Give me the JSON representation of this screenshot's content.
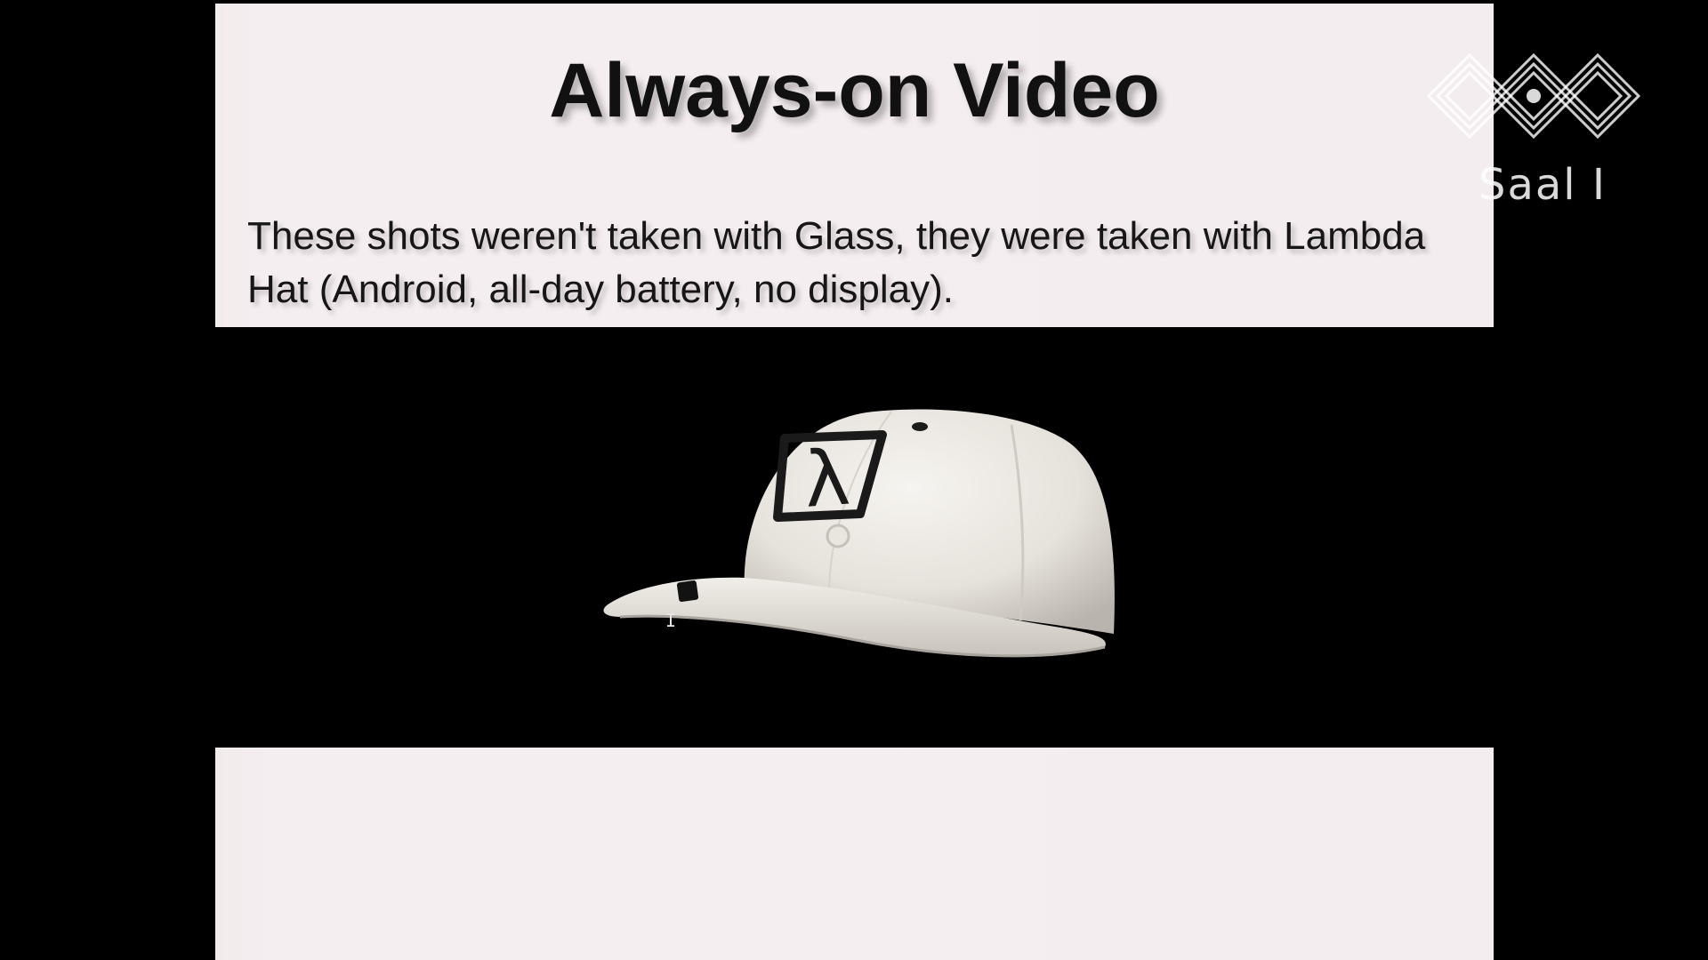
{
  "slide": {
    "title": "Always-on Video",
    "body": "These shots weren't taken with Glass, they were taken with Lambda Hat (Android, all-day battery, no display)."
  },
  "hat": {
    "logo_glyph": "λ",
    "cap_color": "#ece9e4",
    "logo_color": "#1a1a1a"
  },
  "overlay": {
    "room_label": "Saal I",
    "logo_icon": "ccc-logo-icon",
    "cursor_glyph": "I"
  },
  "colors": {
    "background": "#000000",
    "slide_panel": "#f4edef",
    "text": "#111111"
  }
}
